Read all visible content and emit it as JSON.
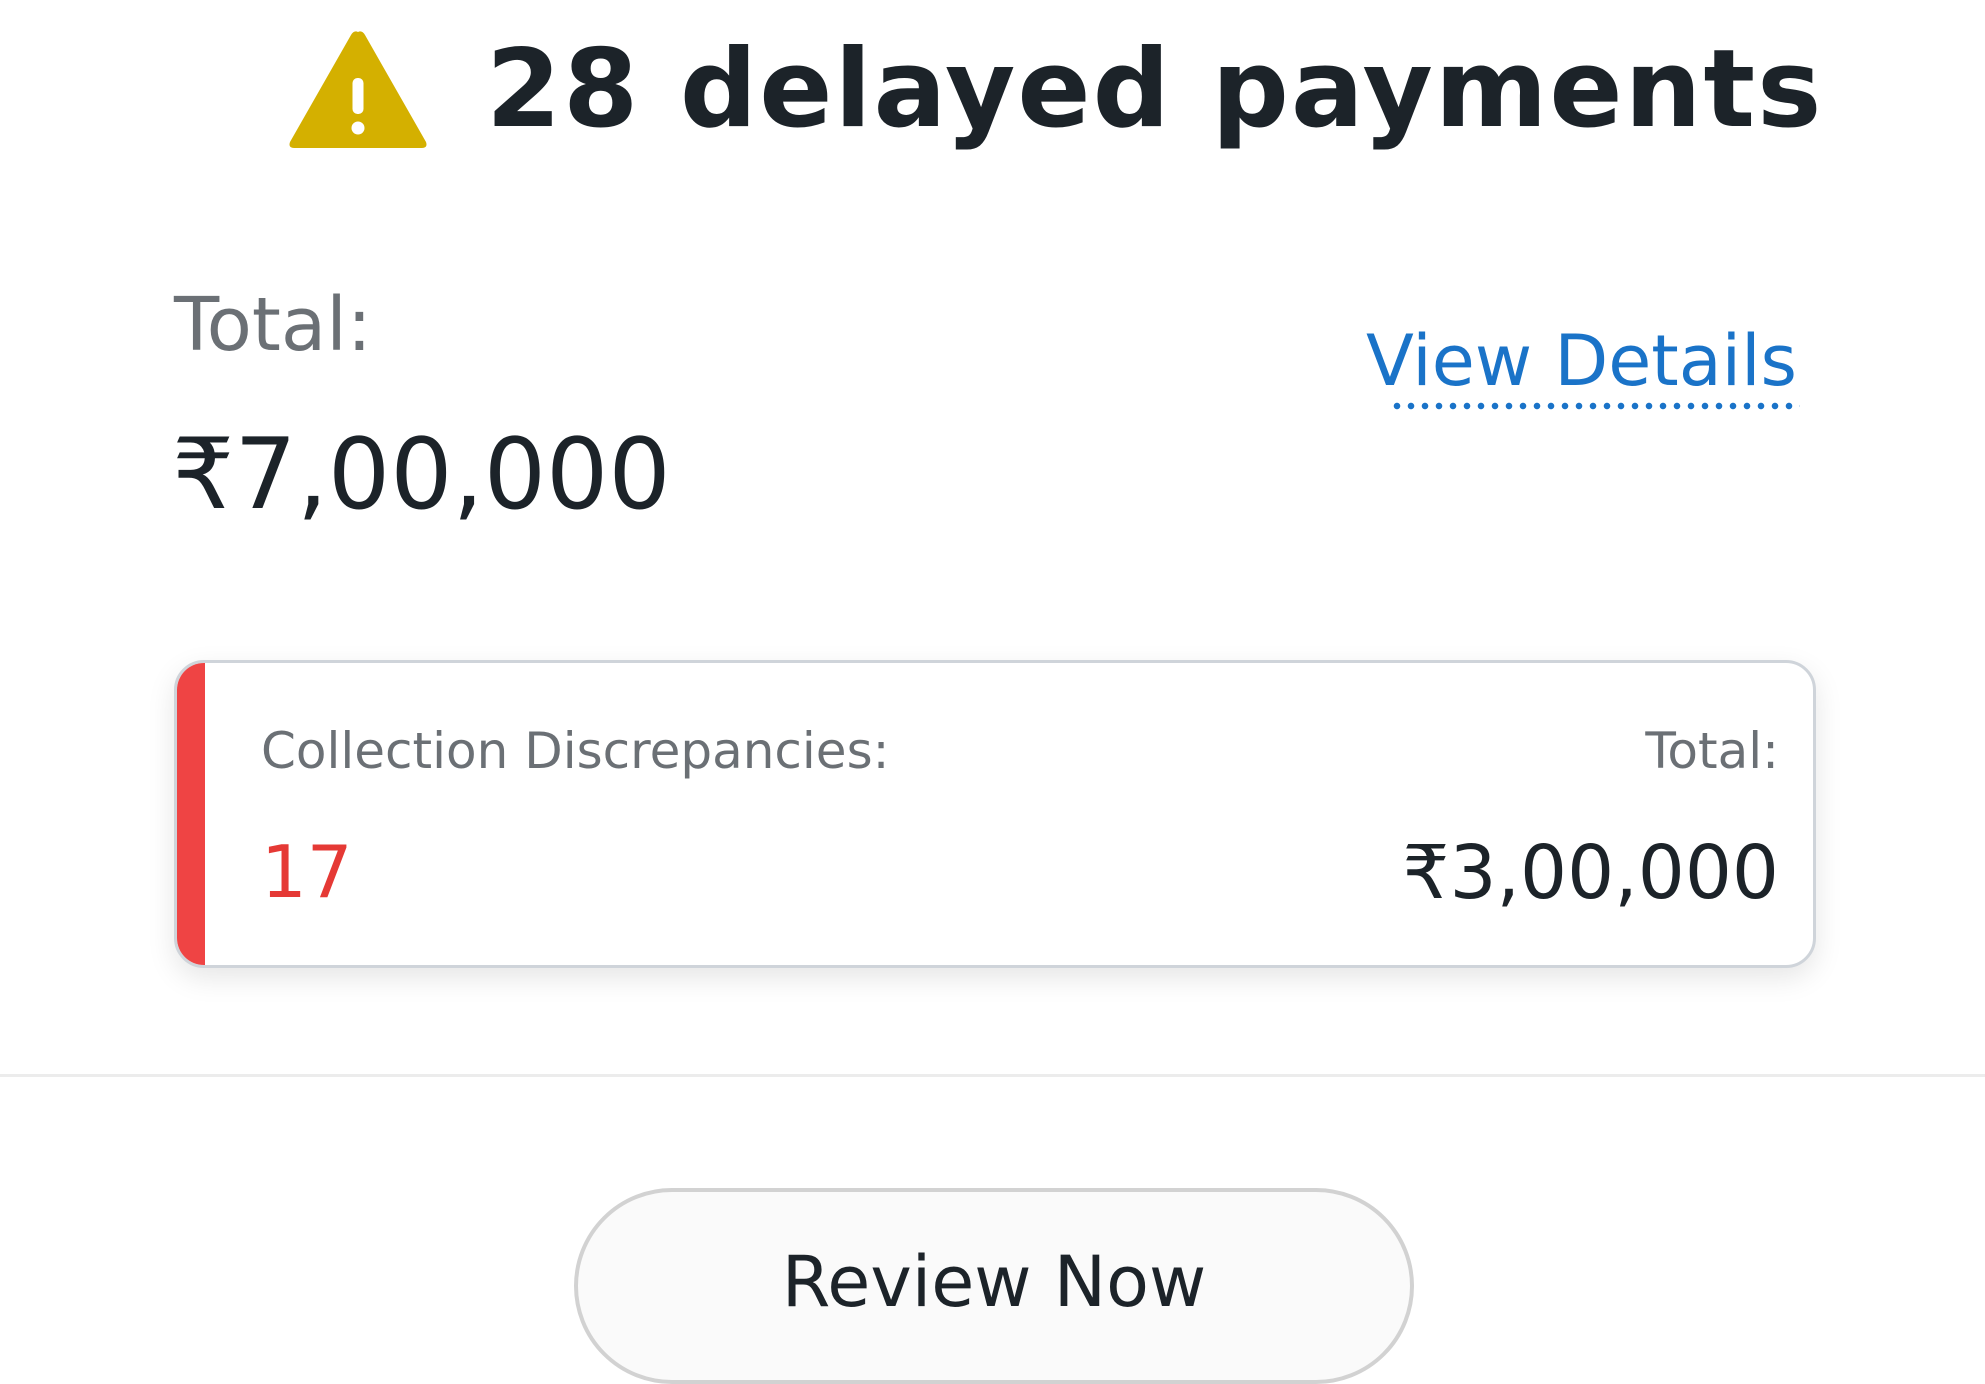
{
  "header": {
    "icon": "warning-triangle-icon",
    "icon_color": "#d4b000",
    "title": "28 delayed payments"
  },
  "summary": {
    "total_label": "Total:",
    "total_amount": "₹7,00,000",
    "view_details_label": "View Details"
  },
  "discrepancy_card": {
    "label": "Collection Discrepancies:",
    "count": "17",
    "total_label": "Total:",
    "total_amount": "₹3,00,000",
    "accent_color": "#ef4444"
  },
  "actions": {
    "review_label": "Review Now"
  },
  "colors": {
    "link": "#1a73c8",
    "text_primary": "#1c2329",
    "text_secondary": "#6b7075",
    "danger": "#e53935"
  }
}
